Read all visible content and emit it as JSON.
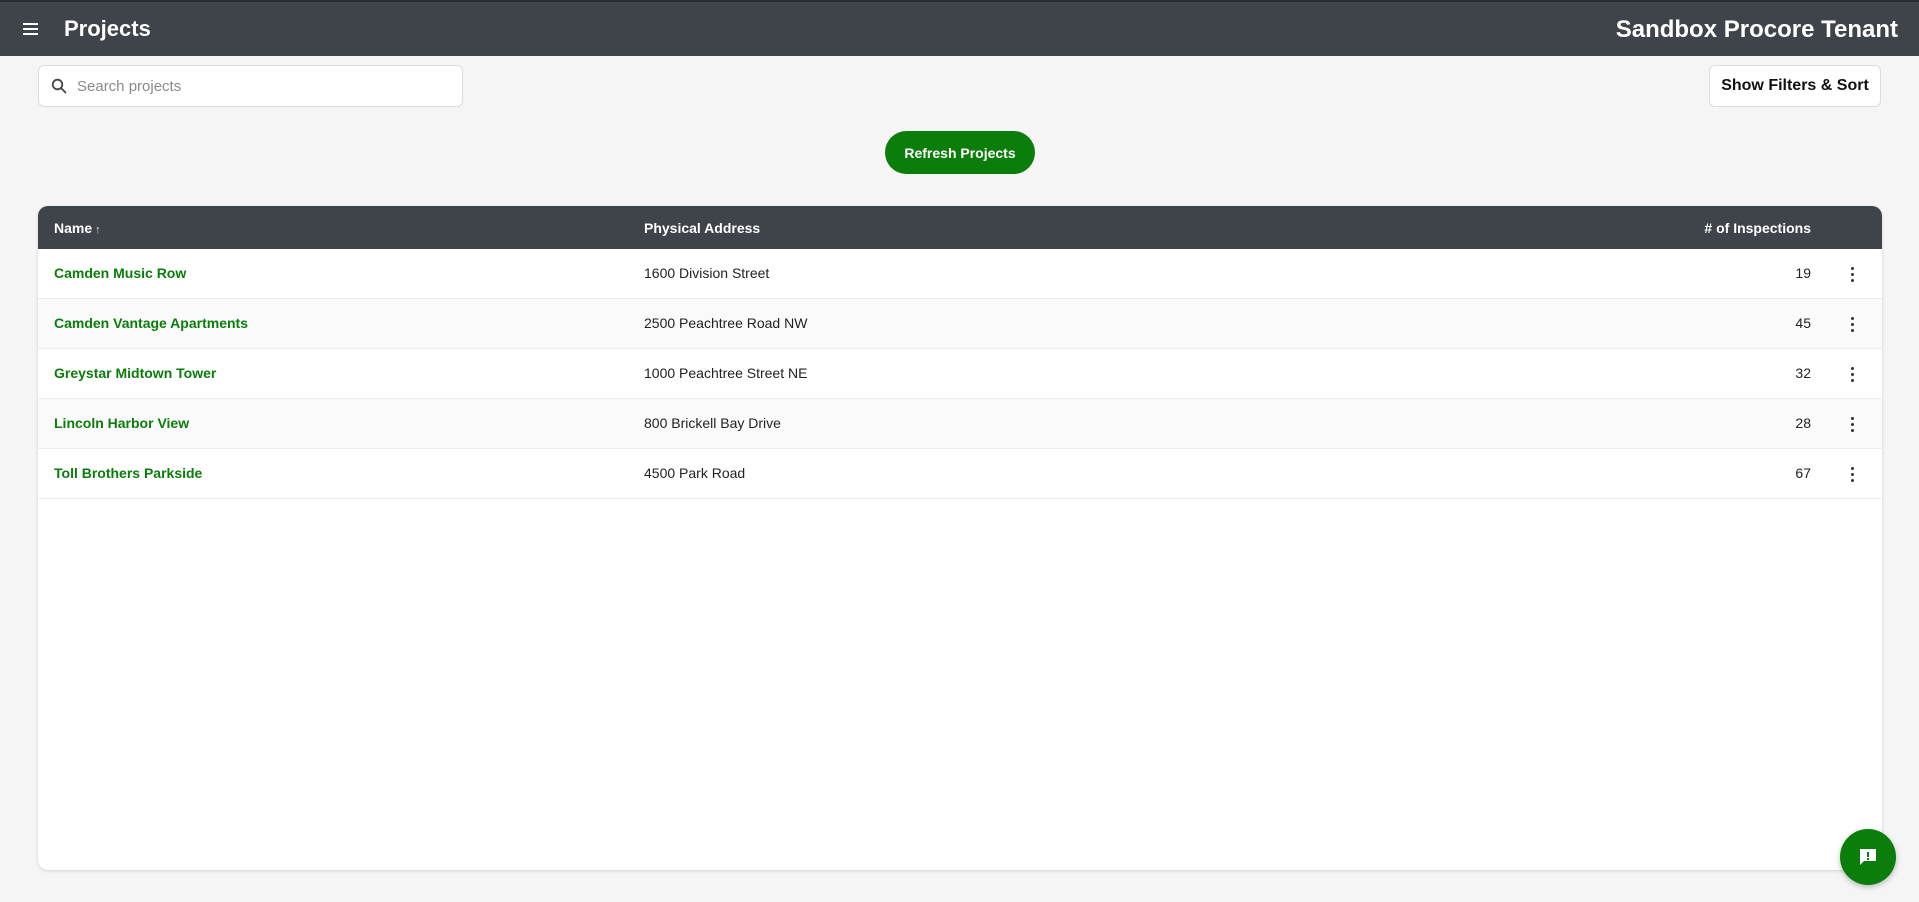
{
  "header": {
    "page_title": "Projects",
    "tenant_name": "Sandbox Procore Tenant"
  },
  "search": {
    "placeholder": "Search projects",
    "value": ""
  },
  "toolbar": {
    "filters_label": "Show Filters & Sort",
    "refresh_label": "Refresh Projects"
  },
  "table": {
    "columns": {
      "name": "Name",
      "name_sort_indicator": "↑",
      "address": "Physical Address",
      "inspections": "# of Inspections"
    },
    "rows": [
      {
        "name": "Camden Music Row",
        "address": "1600 Division Street",
        "inspections": "19"
      },
      {
        "name": "Camden Vantage Apartments",
        "address": "2500 Peachtree Road NW",
        "inspections": "45"
      },
      {
        "name": "Greystar Midtown Tower",
        "address": "1000 Peachtree Street NE",
        "inspections": "32"
      },
      {
        "name": "Lincoln Harbor View",
        "address": "800 Brickell Bay Drive",
        "inspections": "28"
      },
      {
        "name": "Toll Brothers Parkside",
        "address": "4500 Park Road",
        "inspections": "67"
      }
    ]
  },
  "icons": {
    "menu": "hamburger-menu-icon",
    "search": "search-icon",
    "row_actions": "more-vertical-icon",
    "chat": "feedback-chat-icon"
  },
  "colors": {
    "header_bg": "#3f444b",
    "accent_green": "#0a7d0a",
    "page_bg": "#f5f5f5"
  }
}
